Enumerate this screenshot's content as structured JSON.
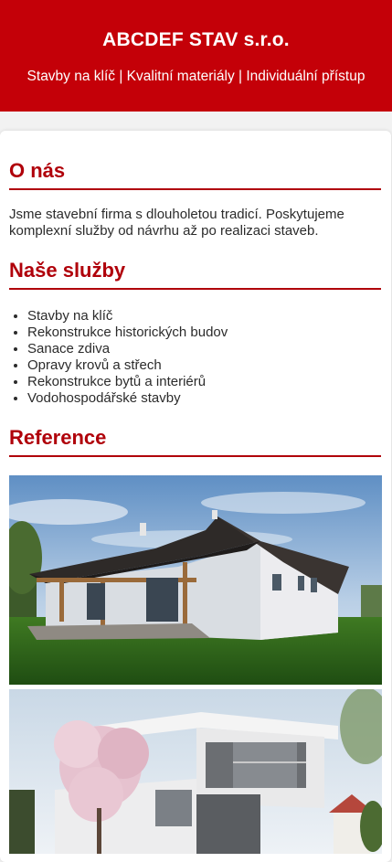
{
  "header": {
    "title": "ABCDEF STAV s.r.o.",
    "tagline": "Stavby na klíč | Kvalitní materiály | Individuální přístup"
  },
  "about": {
    "heading": "O nás",
    "text": "Jsme stavební firma s dlouholetou tradicí. Poskytujeme komplexní služby od návrhu až po realizaci staveb."
  },
  "services": {
    "heading": "Naše služby",
    "items": [
      "Stavby na klíč",
      "Rekonstrukce historických budov",
      "Sanace zdiva",
      "Opravy krovů a střech",
      "Rekonstrukce bytů a interiérů",
      "Vodohospodářské stavby"
    ]
  },
  "references": {
    "heading": "Reference"
  },
  "colors": {
    "brand_red": "#c40008",
    "heading_red": "#b0000a",
    "background": "#f2f2f2"
  }
}
